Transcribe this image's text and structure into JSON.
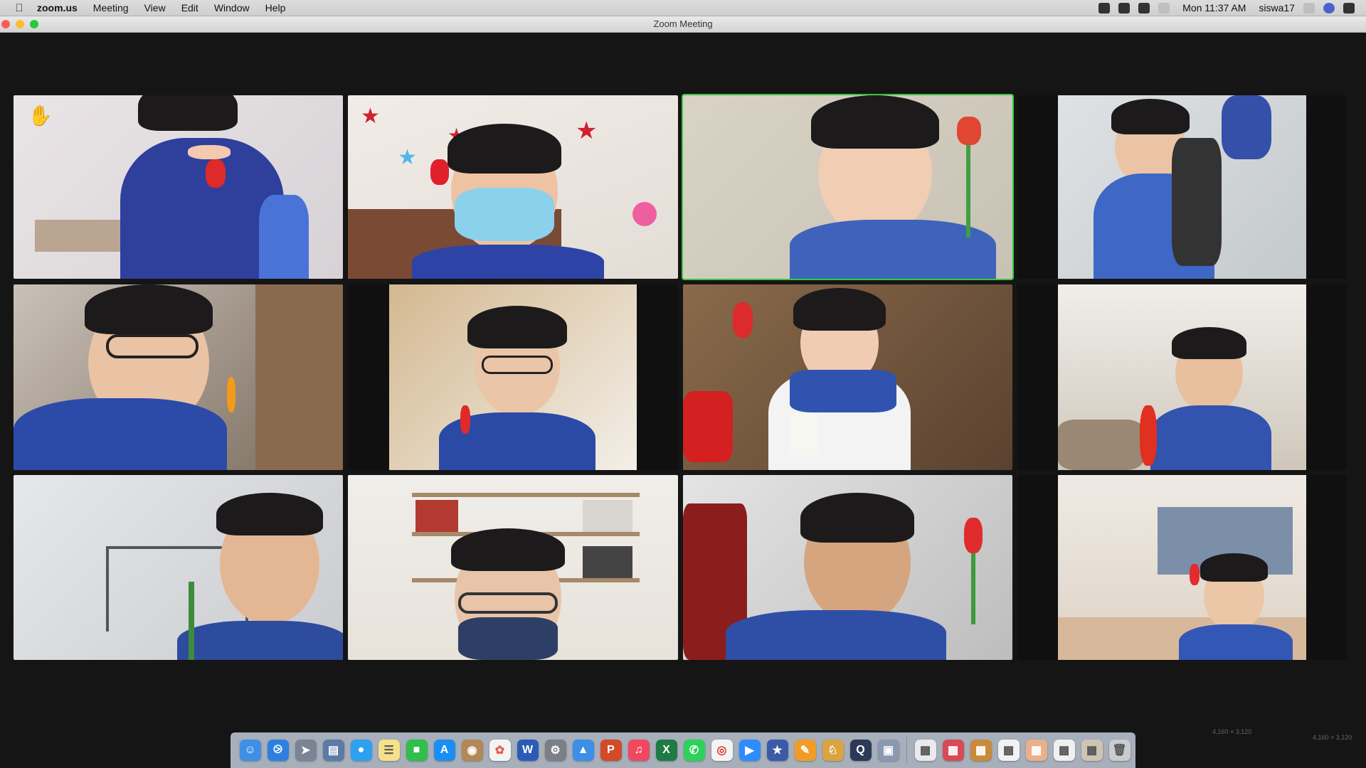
{
  "menubar": {
    "app_name": "zoom.us",
    "items": [
      "Meeting",
      "View",
      "Edit",
      "Window",
      "Help"
    ],
    "clock": "Mon 11:37 AM",
    "user": "siswa17"
  },
  "window": {
    "title": "Zoom Meeting"
  },
  "gallery": {
    "active_speaker_index": 2,
    "raised_hand_index": 0
  },
  "dock": {
    "apps": [
      "finder-icon",
      "safari-icon",
      "launchpad-icon",
      "preview-icon",
      "messages-icon",
      "notes-icon",
      "facetime-icon",
      "app-store-icon",
      "contacts-icon",
      "photos-icon",
      "word-icon",
      "system-preferences-icon",
      "keynote-icon",
      "powerpoint-icon",
      "music-icon",
      "excel-icon",
      "whatsapp-icon",
      "chrome-icon",
      "zoom-icon",
      "telescope-icon",
      "pages-icon",
      "lion-icon",
      "quicktime-icon",
      "image-capture-icon"
    ],
    "minimized": [
      "window-thumb-1",
      "window-thumb-2",
      "window-thumb-3",
      "window-thumb-4",
      "window-thumb-5",
      "window-thumb-6",
      "window-thumb-7"
    ]
  },
  "watermarks": [
    "4,160 × 3,120",
    "4,160 × 3,120"
  ]
}
